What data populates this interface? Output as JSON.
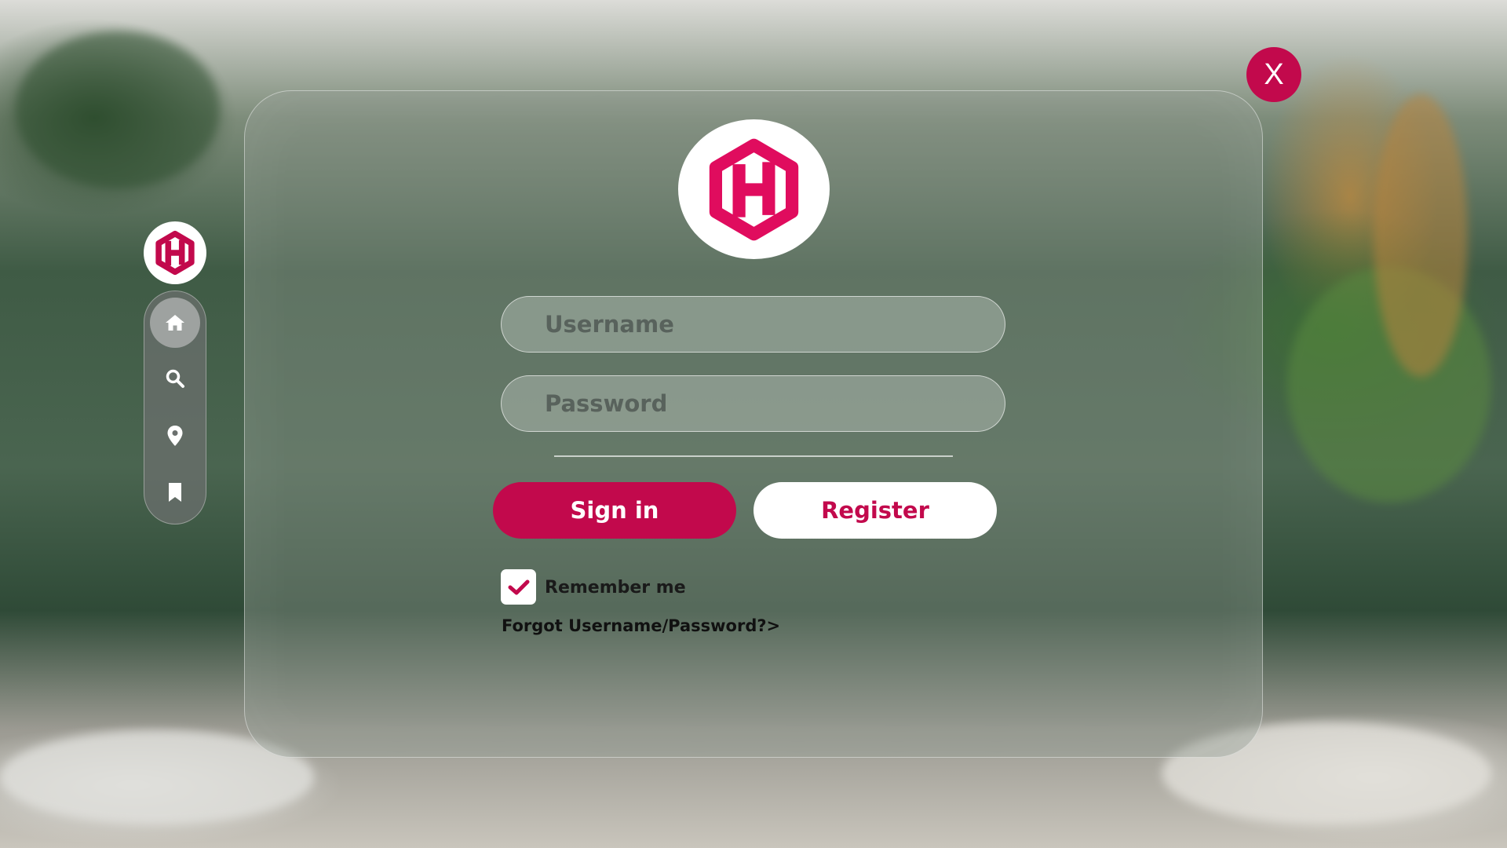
{
  "window": {
    "close_label": "X"
  },
  "sidebar": {
    "logo_icon": "hexagon-h-logo-icon",
    "items": [
      {
        "icon": "home-icon",
        "active": true
      },
      {
        "icon": "search-icon",
        "active": false
      },
      {
        "icon": "location-pin-icon",
        "active": false
      },
      {
        "icon": "bookmark-icon",
        "active": false
      }
    ]
  },
  "login": {
    "logo_icon": "hexagon-h-logo-icon",
    "username_placeholder": "Username",
    "password_placeholder": "Password",
    "signin_label": "Sign in",
    "register_label": "Register",
    "remember_label": "Remember me",
    "remember_checked": true,
    "forgot_label": "Forgot Username/Password?>"
  },
  "colors": {
    "accent": "#c2094c",
    "button_text_light": "#ffffff"
  }
}
